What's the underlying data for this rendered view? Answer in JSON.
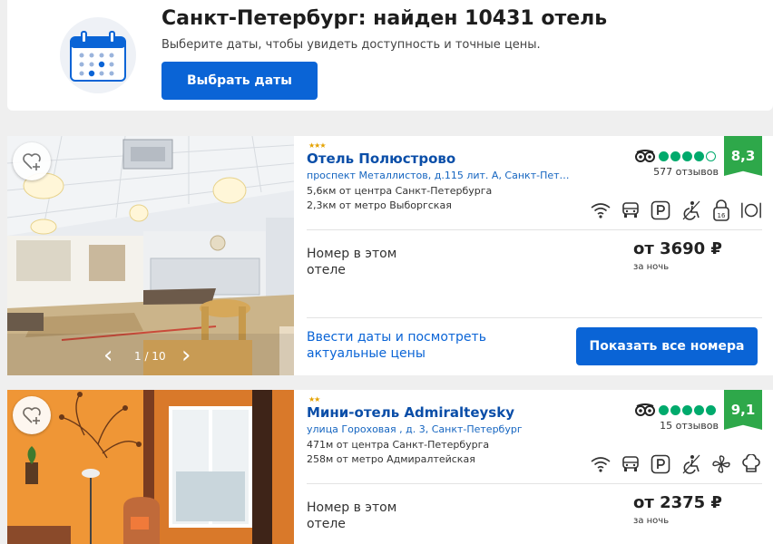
{
  "header": {
    "title": "Санкт-Петербург: найден 10431 отель",
    "subtitle": "Выберите даты, чтобы увидеть доступность и точные цены.",
    "select_dates_label": "Выбрать даты"
  },
  "colors": {
    "accent": "#0a64d6",
    "score_green": "#2ea84a",
    "tripadvisor_green": "#00aa6c",
    "star_gold": "#e4a200"
  },
  "hotels": [
    {
      "stars": "★★★",
      "star_count": 3,
      "name": "Отель Полюстрово",
      "address": "проспект Металлистов, д.115 лит. А, Санкт-Петер...",
      "distance_center": "5,6км от центра Санкт-Петербурга",
      "distance_metro": "2,3км от метро Выборгская",
      "ta_rating": 4,
      "reviews": "577 отзывов",
      "score": "8,3",
      "amenities": [
        "wifi-icon",
        "car-icon",
        "parking-icon",
        "accessible-icon",
        "age-16-icon",
        "restaurant-icon"
      ],
      "room_text": "Номер в этом отеле",
      "price": "от 3690 ₽",
      "per_night": "за ночь",
      "photo_counter": "1 / 10",
      "enter_dates_text": "Ввести даты и посмотреть актуальные цены",
      "show_rooms_label": "Показать все номера"
    },
    {
      "stars": "★★",
      "star_count": 2,
      "name": "Мини-отель Admiralteysky",
      "address": "улица Гороховая , д. 3, Санкт-Петербург",
      "distance_center": "471м от центра Санкт-Петербурга",
      "distance_metro": "258м от метро Адмиралтейская",
      "ta_rating": 5,
      "reviews": "15 отзывов",
      "score": "9,1",
      "amenities": [
        "wifi-icon",
        "car-icon",
        "parking-icon",
        "accessible-icon",
        "fan-icon",
        "chef-hat-icon"
      ],
      "room_text": "Номер в этом отеле",
      "price": "от 2375 ₽",
      "per_night": "за ночь"
    }
  ]
}
